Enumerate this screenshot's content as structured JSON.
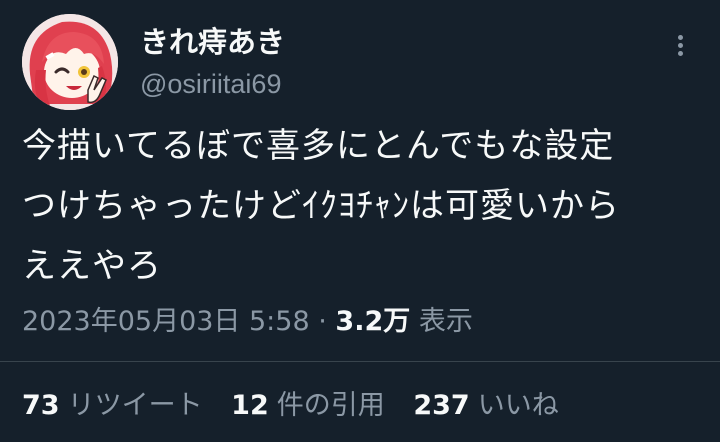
{
  "user": {
    "display_name": "きれ痔あき",
    "handle": "@osiriitai69"
  },
  "tweet": {
    "lines": [
      "今描いてるぼで喜多にとんでもな設定",
      "つけちゃったけどｲｸﾖﾁｬﾝは可愛いから",
      "ええやろ"
    ]
  },
  "meta": {
    "timestamp": "2023年05月03日 5:58",
    "separator": "·",
    "views_count": "3.2万",
    "views_label": "表示"
  },
  "stats": {
    "retweets_count": "73",
    "retweets_label": "リツイート",
    "quotes_count": "12",
    "quotes_label": "件の引用",
    "likes_count": "237",
    "likes_label": "いいね"
  },
  "icons": {
    "more": "more-horizontal-icon",
    "avatar": "avatar-image"
  },
  "colors": {
    "background": "#15202b",
    "text_primary": "#f7f9f9",
    "text_secondary": "#8b98a5",
    "divider": "#38444d"
  }
}
